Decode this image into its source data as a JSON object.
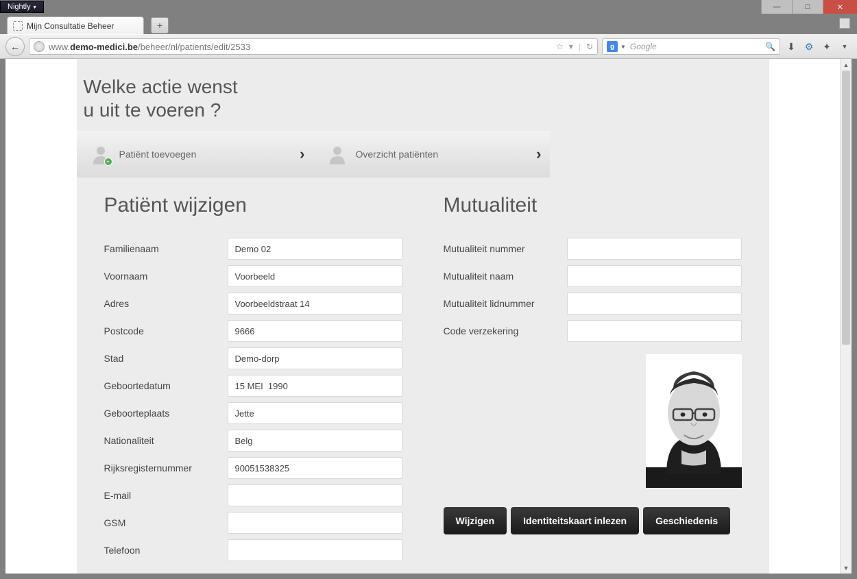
{
  "browser": {
    "nightly_label": "Nightly",
    "tab_title": "Mijn Consultatie Beheer",
    "url_prefix": "www.",
    "url_domain": "demo-medici.be",
    "url_path": "/beheer/nl/patients/edit/2533",
    "search_placeholder": "Google"
  },
  "heading_line1": "Welke actie wenst",
  "heading_line2": "u uit te voeren ?",
  "actions": {
    "add_patient": "Patiënt toevoegen",
    "overview_patients": "Overzicht patiënten"
  },
  "sections": {
    "edit_patient": "Patiënt wijzigen",
    "mutuality": "Mutualiteit"
  },
  "labels": {
    "familienaam": "Familienaam",
    "voornaam": "Voornaam",
    "adres": "Adres",
    "postcode": "Postcode",
    "stad": "Stad",
    "geboortedatum": "Geboortedatum",
    "geboorteplaats": "Geboorteplaats",
    "nationaliteit": "Nationaliteit",
    "rijksregisternummer": "Rijksregisternummer",
    "email": "E-mail",
    "gsm": "GSM",
    "telefoon": "Telefoon",
    "mut_nummer": "Mutualiteit nummer",
    "mut_naam": "Mutualiteit naam",
    "mut_lidnummer": "Mutualiteit lidnummer",
    "code_verzekering": "Code verzekering"
  },
  "values": {
    "familienaam": "Demo 02",
    "voornaam": "Voorbeeld",
    "adres": "Voorbeeldstraat 14",
    "postcode": "9666",
    "stad": "Demo-dorp",
    "geboortedatum": "15 MEI  1990",
    "geboorteplaats": "Jette",
    "nationaliteit": "Belg",
    "rijksregisternummer": "90051538325",
    "email": "",
    "gsm": "",
    "telefoon": "",
    "mut_nummer": "",
    "mut_naam": "",
    "mut_lidnummer": "",
    "code_verzekering": ""
  },
  "buttons": {
    "wijzigen": "Wijzigen",
    "id_inlezen": "Identiteitskaart inlezen",
    "geschiedenis": "Geschiedenis"
  }
}
